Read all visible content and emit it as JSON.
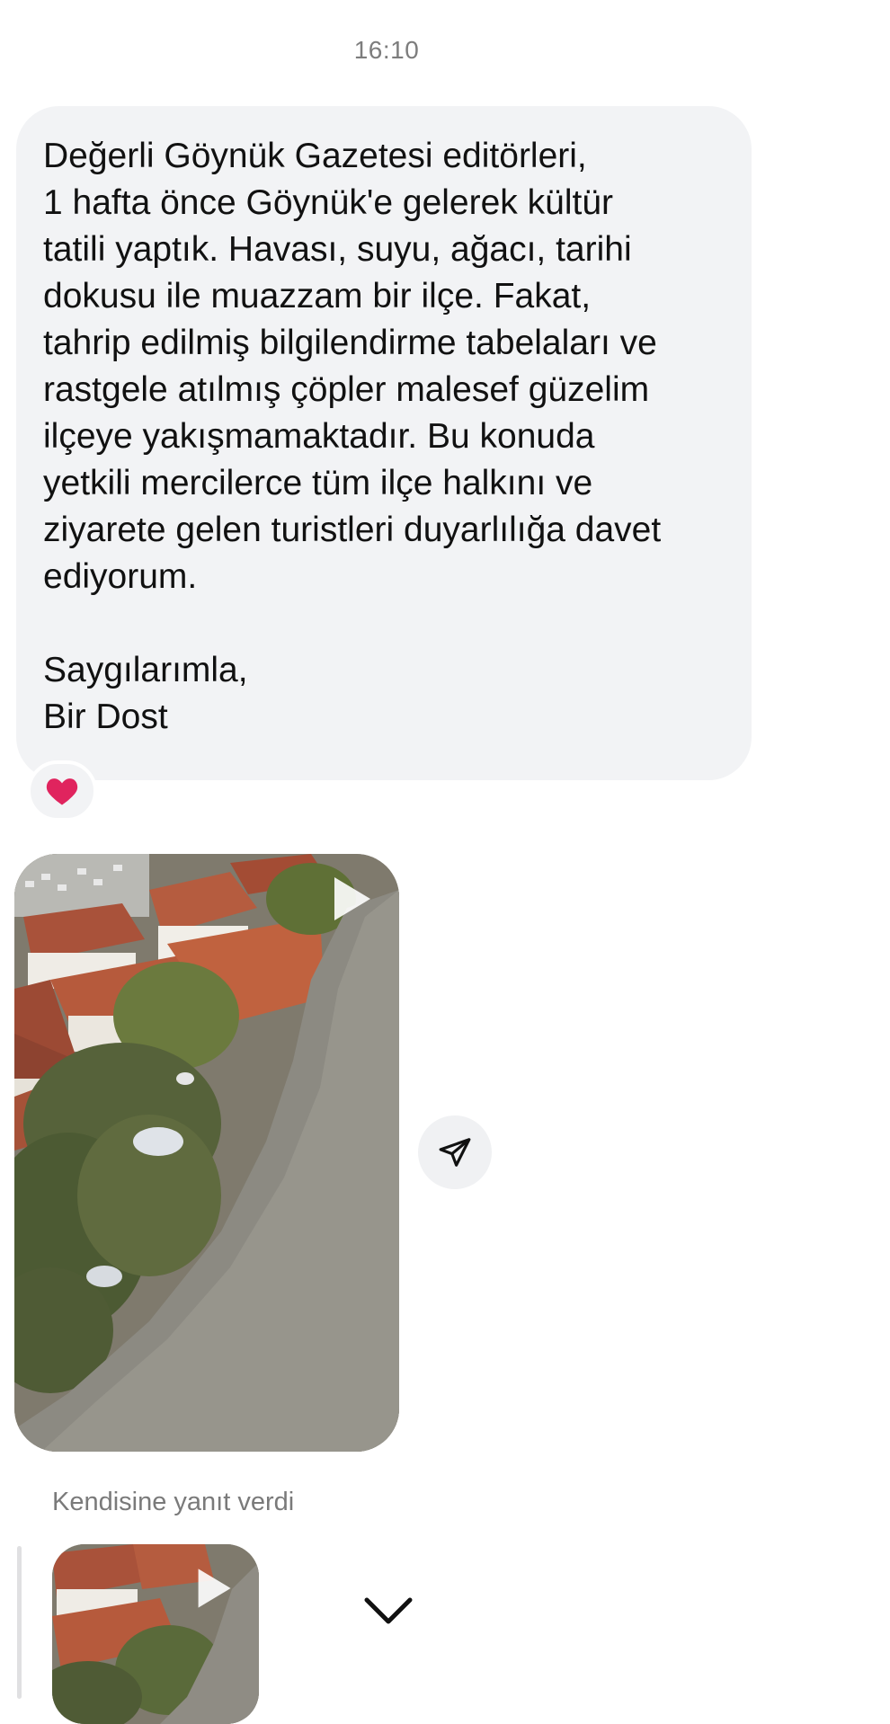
{
  "timestamp": "16:10",
  "message": {
    "greeting": "Değerli Göynük Gazetesi editörleri,",
    "body_lines": [
      "1 hafta önce Göynük'e gelerek kültür",
      "tatili yaptık. Havası, suyu, ağacı, tarihi",
      "dokusu ile muazzam bir ilçe. Fakat,",
      "tahrip edilmiş bilgilendirme tabelaları ve",
      "rastgele atılmış çöpler malesef güzelim",
      "ilçeye yakışmamaktadır. Bu konuda",
      "yetkili mercilerce tüm ilçe halkını ve",
      "ziyarete gelen turistleri duyarlılığa davet",
      "ediyorum."
    ],
    "closing": "Saygılarımla,",
    "signature": "Bir Dost",
    "reaction_icon": "heart-icon",
    "reaction_emoji": "❤️"
  },
  "video": {
    "play_icon": "play-icon",
    "share_icon": "paper-plane-icon"
  },
  "reply": {
    "label": "Kendisine yanıt verdi",
    "expand_icon": "chevron-down-icon"
  },
  "colors": {
    "bubble_bg": "#f2f3f5",
    "timestamp": "#7d7d7d",
    "reaction_heart": "#e0245e"
  }
}
